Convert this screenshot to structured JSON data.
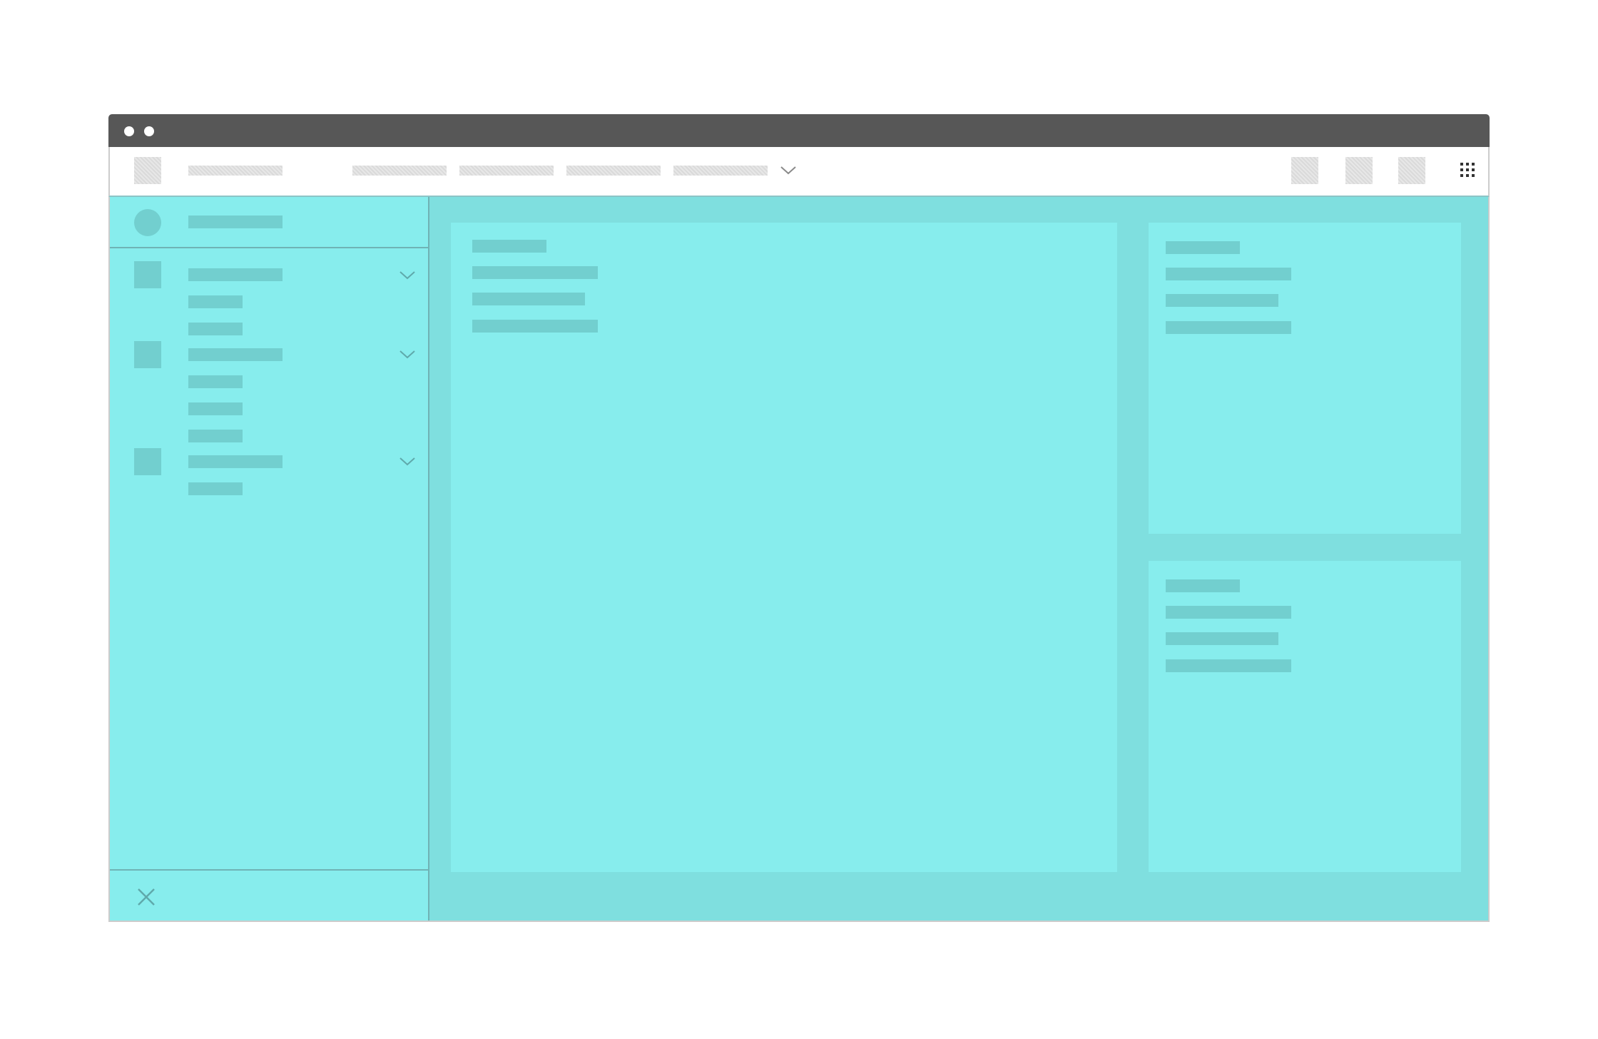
{
  "window": {
    "traffic_lights": [
      "window-control-dot",
      "window-control-dot"
    ]
  },
  "topbar": {
    "logo_icon": "logo-placeholder-icon",
    "title": "",
    "nav_items": [
      "",
      "",
      "",
      ""
    ],
    "nav_more_icon": "chevron-down-icon",
    "action_icons": [
      "placeholder-icon",
      "placeholder-icon",
      "placeholder-icon"
    ],
    "apps_icon": "grid-dots-icon"
  },
  "sidebar": {
    "user": {
      "avatar_icon": "avatar-icon",
      "name": ""
    },
    "groups": [
      {
        "icon": "square-icon",
        "label": "",
        "expand_icon": "chevron-down-icon",
        "items": [
          "",
          ""
        ]
      },
      {
        "icon": "square-icon",
        "label": "",
        "expand_icon": "chevron-down-icon",
        "items": [
          "",
          "",
          ""
        ]
      },
      {
        "icon": "square-icon",
        "label": "",
        "expand_icon": "chevron-down-icon",
        "items": [
          ""
        ]
      }
    ],
    "footer": {
      "close_icon": "close-icon"
    }
  },
  "main": {
    "panel": {
      "lines": [
        "",
        "",
        "",
        ""
      ]
    }
  },
  "right": {
    "panels": [
      {
        "lines": [
          "",
          "",
          "",
          ""
        ]
      },
      {
        "lines": [
          "",
          "",
          "",
          ""
        ]
      }
    ]
  },
  "colors": {
    "titlebar": "#575757",
    "content_background": "#7fdfdf",
    "panel_background": "#87eded",
    "placeholder_bar": "#72cfcf",
    "divider": "#6fb3b5"
  }
}
